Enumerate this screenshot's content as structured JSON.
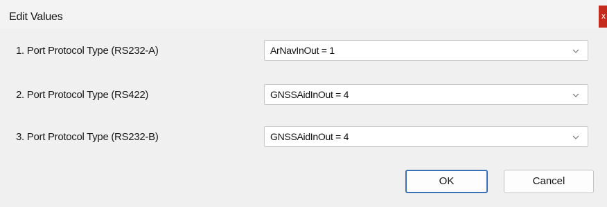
{
  "dialog": {
    "title": "Edit Values",
    "close_label": "x"
  },
  "rows": [
    {
      "label": "1. Port Protocol Type (RS232-A)",
      "value": "ArNavInOut = 1"
    },
    {
      "label": "2. Port Protocol Type (RS422)",
      "value": "GNSSAidInOut = 4"
    },
    {
      "label": "3. Port Protocol Type (RS232-B)",
      "value": "GNSSAidInOut = 4"
    }
  ],
  "buttons": {
    "ok_label": "OK",
    "cancel_label": "Cancel"
  },
  "icons": {
    "dropdown": "chevron-down-icon",
    "close": "close-icon"
  },
  "colors": {
    "close_bg": "#c42b1c",
    "ok_border": "#3a70b4"
  }
}
